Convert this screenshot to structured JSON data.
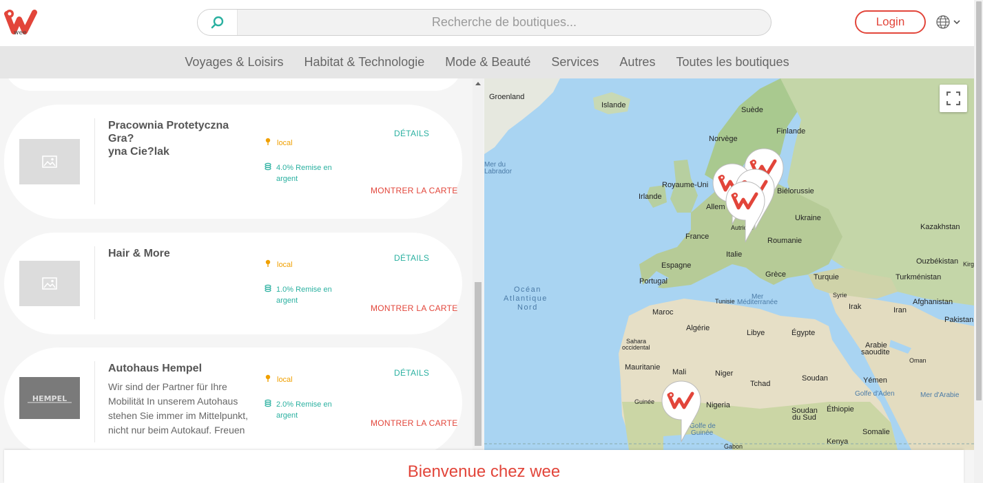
{
  "brand": {
    "logo_text": "wee",
    "accent": "#e2453a",
    "teal": "#2ab0a0"
  },
  "search": {
    "placeholder": "Recherche de boutiques..."
  },
  "header": {
    "login_label": "Login",
    "language_icon": "globe-icon"
  },
  "nav": {
    "items": [
      "Voyages & Loisirs",
      "Habitat & Technologie",
      "Mode & Beauté",
      "Services",
      "Autres",
      "Toutes les boutiques"
    ]
  },
  "shops": [
    {
      "name": "Pracownia Protetyczna Gra?yna Cie?lak",
      "name_line1": "Pracownia Protetyczna Gra?",
      "name_line2": "yna Cie?lak",
      "description": "",
      "location": "local",
      "cashback_line1": "4.0% Remise en",
      "cashback_line2": "argent",
      "details_label": "DÉTAILS",
      "map_label": "MONTRER LA CARTE"
    },
    {
      "name": "Hair & More",
      "description": "",
      "location": "local",
      "cashback_line1": "1.0% Remise en",
      "cashback_line2": "argent",
      "details_label": "DÉTAILS",
      "map_label": "MONTRER LA CARTE"
    },
    {
      "name": "Autohaus Hempel",
      "description_lines": [
        "Wir sind der Partner für Ihre",
        "Mobilität In unserem Autohaus",
        "stehen Sie immer im Mittelpunkt,",
        "nicht nur beim Autokauf. Freuen"
      ],
      "location": "local",
      "cashback_line1": "2.0% Remise en",
      "cashback_line2": "argent",
      "details_label": "DÉTAILS",
      "map_label": "MONTRER LA CARTE",
      "logo_text": "HEMPEL"
    }
  ],
  "map": {
    "labels": {
      "groenland": "Groenland",
      "islande": "Islande",
      "suede": "Suède",
      "finlande": "Finlande",
      "norvege": "Norvège",
      "mer_du": "Mer du",
      "labrador": "Labrador",
      "royaume_uni": "Royaume-Uni",
      "irlande": "Irlande",
      "bielorussie": "Biélorussie",
      "allemagne": "Allem",
      "ukraine": "Ukraine",
      "kazakhstan": "Kazakhstan",
      "autriche": "Autriche",
      "france": "France",
      "roumanie": "Roumanie",
      "italie": "Italie",
      "espagne": "Espagne",
      "ouzbekistan": "Ouzbékistan",
      "kirg": "Kirg",
      "portugal": "Portugal",
      "grece": "Grèce",
      "turquie": "Turquie",
      "turkmenistan": "Turkménistan",
      "ocean1": "Océan",
      "ocean2": "Atlantique",
      "ocean3": "Nord",
      "tunisie": "Tunisie",
      "mer": "Mer",
      "mediterranee": "Méditerranée",
      "syrie": "Syrie",
      "afghanistan": "Afghanistan",
      "irak": "Irak",
      "iran": "Iran",
      "pakistan": "Pakistan",
      "maroc": "Maroc",
      "algerie": "Algérie",
      "libye": "Libye",
      "egypte": "Égypte",
      "sahara1": "Sahara",
      "sahara2": "occidental",
      "arabie1": "Arabie",
      "arabie2": "saoudite",
      "oman": "Oman",
      "mauritanie": "Mauritanie",
      "mali": "Mali",
      "niger": "Niger",
      "tchad": "Tchad",
      "soudan": "Soudan",
      "yemen": "Yémen",
      "golfe_aden": "Golfe d'Aden",
      "mer_arabie": "Mer d'Arabie",
      "guinee": "Guinée",
      "nigeria": "Nigeria",
      "soudan_sud1": "Soudan",
      "soudan_sud2": "du Sud",
      "ethiopie": "Éthiopie",
      "golfe1": "Golfe de",
      "golfe2": "Guinée",
      "somalie": "Somalie",
      "kenya": "Kenya",
      "gabon": "Gabon"
    }
  },
  "footer": {
    "welcome": "Bienvenue chez wee"
  }
}
